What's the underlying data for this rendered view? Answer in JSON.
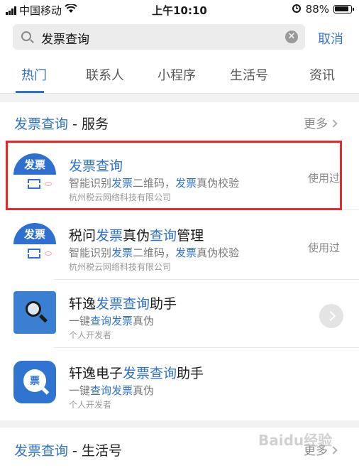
{
  "status_bar": {
    "carrier": "中国移动",
    "time": "上午10:10",
    "battery": "88%"
  },
  "search": {
    "query": "发票查询",
    "cancel_label": "取消"
  },
  "tabs": [
    {
      "label": "热门",
      "active": true
    },
    {
      "label": "联系人",
      "active": false
    },
    {
      "label": "小程序",
      "active": false
    },
    {
      "label": "生活号",
      "active": false
    },
    {
      "label": "资讯",
      "active": false
    }
  ],
  "services_section": {
    "title_hl": "发票查询",
    "title_rest": " - 服务",
    "more_label": "更多"
  },
  "results": [
    {
      "name_parts": [
        "",
        "发票查询",
        ""
      ],
      "desc_parts": [
        "智能识别",
        "发票",
        "二维码，",
        "发票",
        "真伪校验"
      ],
      "org": "杭州税云网络科技有限公司",
      "status": "使用过",
      "logo_text": "发票"
    },
    {
      "name_parts": [
        "税问",
        "发票",
        "真伪",
        "查询",
        "管理"
      ],
      "desc_parts": [
        "智能识别",
        "发票",
        "二维码，",
        "发票",
        "真伪校验"
      ],
      "org": "杭州税云网络科技有限公司",
      "status": "使用过",
      "logo_text": "发票"
    },
    {
      "name_parts": [
        "轩逸",
        "发票查询",
        "助手"
      ],
      "desc_parts": [
        "一键",
        "查询",
        "",
        "发票",
        "真伪"
      ],
      "org": "个人开发者"
    },
    {
      "name_parts": [
        "轩逸电子",
        "发票查询",
        "助手"
      ],
      "desc_parts": [
        "一键",
        "查询",
        "",
        "发票",
        "真伪"
      ],
      "org": "个人开发者",
      "logo_text": "票"
    }
  ],
  "life_section": {
    "title_hl": "发票查询",
    "title_rest": " - 生活号",
    "more_label": "更多"
  },
  "watermark": "Baidu经验",
  "icons": {
    "signal": "signal-bars-icon",
    "wifi": "wifi-icon",
    "alarm": "alarm-icon",
    "battery": "battery-icon",
    "search": "search-icon",
    "clear": "clear-icon",
    "chevron": "chevron-right-icon"
  },
  "colors": {
    "accent": "#2f73c8",
    "highlight_box": "#e8272b"
  }
}
